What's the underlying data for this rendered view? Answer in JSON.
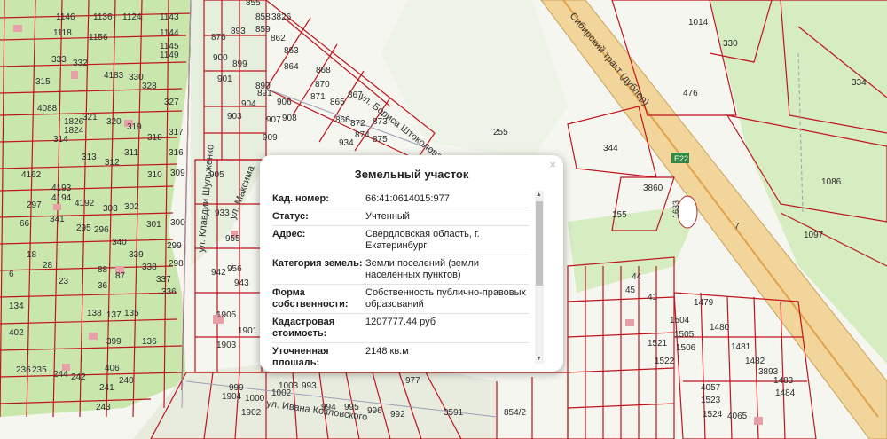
{
  "popup": {
    "title": "Земельный участок",
    "close": "×",
    "rows": [
      {
        "key": "Кад. номер:",
        "value": "66:41:0614015:977"
      },
      {
        "key": "Статус:",
        "value": "Учтенный"
      },
      {
        "key": "Адрес:",
        "value": "Свердловская область, г. Екатеринбург"
      },
      {
        "key": "Категория земель:",
        "value": "Земли поселений (земли населенных пунктов)"
      },
      {
        "key": "Форма собственности:",
        "value": "Собственность публично-правовых образований"
      },
      {
        "key": "Кадастровая стоимость:",
        "value": "1207777.44 руб"
      },
      {
        "key": "Уточненная площадь:",
        "value": "2148 кв.м"
      }
    ]
  },
  "map": {
    "roads": {
      "siberian": "Сибирский тракт (дублер)",
      "shulzhenko": "ул. Клавдии Шульженко",
      "kozlovsky": "ул. Ивана Козловского",
      "boris": "ул. Бориса Штоколова",
      "maxim": "ул. Максима",
      "e22": "E22",
      "km": "7",
      "badge": "1633"
    },
    "labels": [
      "855",
      "1146",
      "1136",
      "1124",
      "1143",
      "1118",
      "1156",
      "1144",
      "1145",
      "1149",
      "333",
      "332",
      "315",
      "4183",
      "330",
      "328",
      "327",
      "4088",
      "321",
      "320",
      "319",
      "318",
      "317",
      "1826",
      "1824",
      "314",
      "313",
      "312",
      "311",
      "310",
      "309",
      "316",
      "4162",
      "4193",
      "4194",
      "4192",
      "303",
      "302",
      "301",
      "300",
      "299",
      "298",
      "297",
      "341",
      "295",
      "296",
      "340",
      "339",
      "338",
      "337",
      "336",
      "66",
      "18",
      "28",
      "6",
      "88",
      "87",
      "23",
      "36",
      "134",
      "138",
      "137",
      "135",
      "136",
      "402",
      "399",
      "406",
      "236",
      "235",
      "244",
      "242",
      "241",
      "240",
      "243",
      "876",
      "900",
      "899",
      "901",
      "893",
      "858",
      "859",
      "3826",
      "862",
      "863",
      "864",
      "868",
      "904",
      "890",
      "891",
      "906",
      "903",
      "907",
      "908",
      "909",
      "905",
      "933",
      "942",
      "943",
      "956",
      "955",
      "870",
      "871",
      "865",
      "866",
      "867",
      "872",
      "874",
      "873",
      "875",
      "934",
      "1014",
      "330",
      "334",
      "476",
      "255",
      "344",
      "3860",
      "155",
      "1086",
      "1097",
      "1905",
      "1901",
      "1903",
      "999",
      "1000",
      "993",
      "994",
      "995",
      "996",
      "992",
      "1904",
      "1902",
      "3591",
      "854/2",
      "1504",
      "1505",
      "1506",
      "1479",
      "1480",
      "1481",
      "1482",
      "3893",
      "1483",
      "1484",
      "1521",
      "1522",
      "4057",
      "4065",
      "1523",
      "1524",
      "45",
      "44",
      "41",
      "1003",
      "1002",
      "977"
    ]
  }
}
